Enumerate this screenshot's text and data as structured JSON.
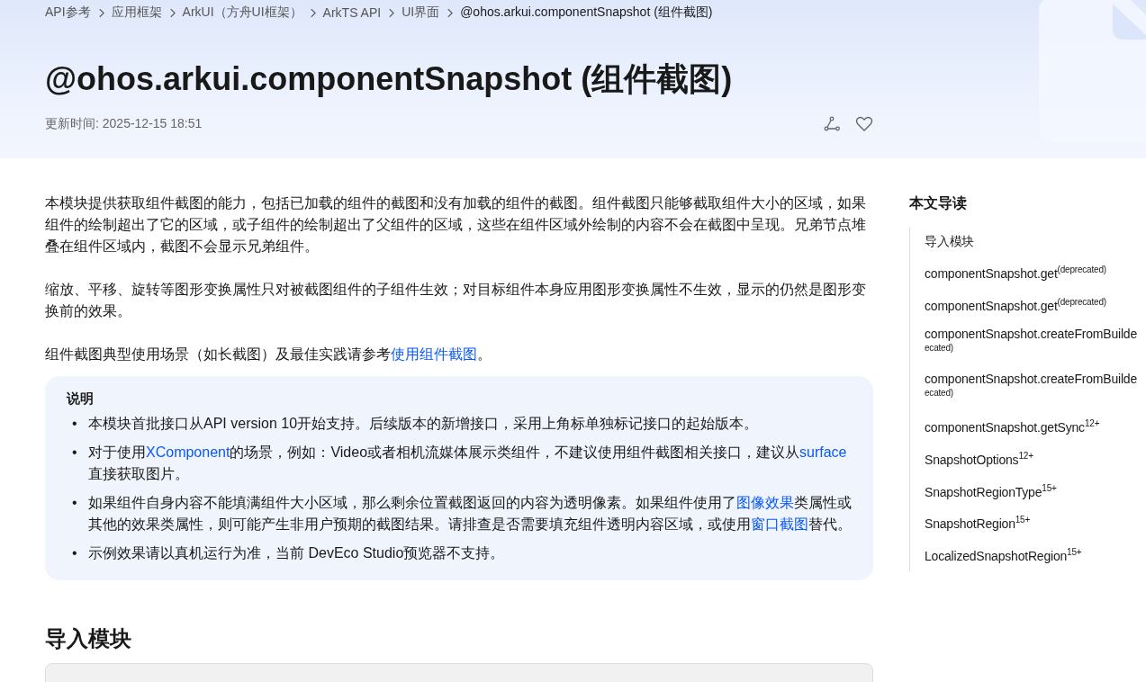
{
  "breadcrumb": [
    {
      "label": "API参考",
      "current": false
    },
    {
      "label": "应用框架",
      "current": false
    },
    {
      "label": "ArkUI（方舟UI框架）",
      "current": false
    },
    {
      "label": "ArkTS API",
      "current": false
    },
    {
      "label": "UI界面",
      "current": false
    },
    {
      "label": "@ohos.arkui.componentSnapshot (组件截图)",
      "current": true
    }
  ],
  "title": "@ohos.arkui.componentSnapshot (组件截图)",
  "updated": "更新时间: 2025-12-15 18:51",
  "paragraphs": [
    [
      {
        "text": "本模块提供获取组件截图的能力，包括已加载的组件的截图和没有加载的组件的截图。组件截图只能够截取组件大小的区域，如果组件的绘制超出了它的区域，或子组件的绘制超出了父组件的区域，这些在组件区域外绘制的内容不会在截图中呈现。兄弟节点堆叠在组件区域内，截图不会显示兄弟组件。"
      }
    ],
    [
      {
        "text": "缩放、平移、旋转等图形变换属性只对被截图组件的子组件生效；对目标组件本身应用图形变换属性不生效，显示的仍然是图形变换前的效果。"
      }
    ],
    [
      {
        "text": "组件截图典型使用场景（如长截图）及最佳实践请参考"
      },
      {
        "link": "使用组件截图"
      },
      {
        "text": "。"
      }
    ]
  ],
  "note": {
    "title": "说明",
    "bullet": "•",
    "items": [
      [
        {
          "text": "本模块首批接口从API version 10开始支持。后续版本的新增接口，采用上角标单独标记接口的起始版本。"
        }
      ],
      [
        {
          "text": "对于使用"
        },
        {
          "link": "XComponent"
        },
        {
          "text": "的场景，例如：Video或者相机流媒体展示类组件，不建议使用组件截图相关接口，建议从"
        },
        {
          "link": "surface"
        },
        {
          "text": "直接获取图片。"
        }
      ],
      [
        {
          "text": "如果组件自身内容不能填满组件大小区域，那么剩余位置截图返回的内容为透明像素。如果组件使用了"
        },
        {
          "link": "图像效果"
        },
        {
          "text": "类属性或其他的效果类属性，则可能产生非用户预期的截图结果。请排查是否需要填充组件透明内容区域，或使用"
        },
        {
          "link": "窗口截图"
        },
        {
          "text": "替代。"
        }
      ],
      [
        {
          "text": "示例效果请以真机运行为准，当前 DevEco Studio预览器不支持。"
        }
      ]
    ]
  },
  "section_heading": "导入模块",
  "toc": {
    "title": "本文导读",
    "items": [
      {
        "label": "导入模块"
      },
      {
        "label": "componentSnapshot.get",
        "sup": "(deprecated)"
      },
      {
        "label": "componentSnapshot.get",
        "sup": "(deprecated)"
      },
      {
        "label": "componentSnapshot.createFromBuilde",
        "wrap": "ecated)"
      },
      {
        "label": "componentSnapshot.createFromBuilde",
        "wrap": "ecated)"
      },
      {
        "label": "componentSnapshot.getSync",
        "sup": "12+"
      },
      {
        "label": "SnapshotOptions",
        "sup": "12+"
      },
      {
        "label": "SnapshotRegionType",
        "sup": "15+"
      },
      {
        "label": "SnapshotRegion",
        "sup": "15+"
      },
      {
        "label": "LocalizedSnapshotRegion",
        "sup": "15+"
      }
    ]
  }
}
